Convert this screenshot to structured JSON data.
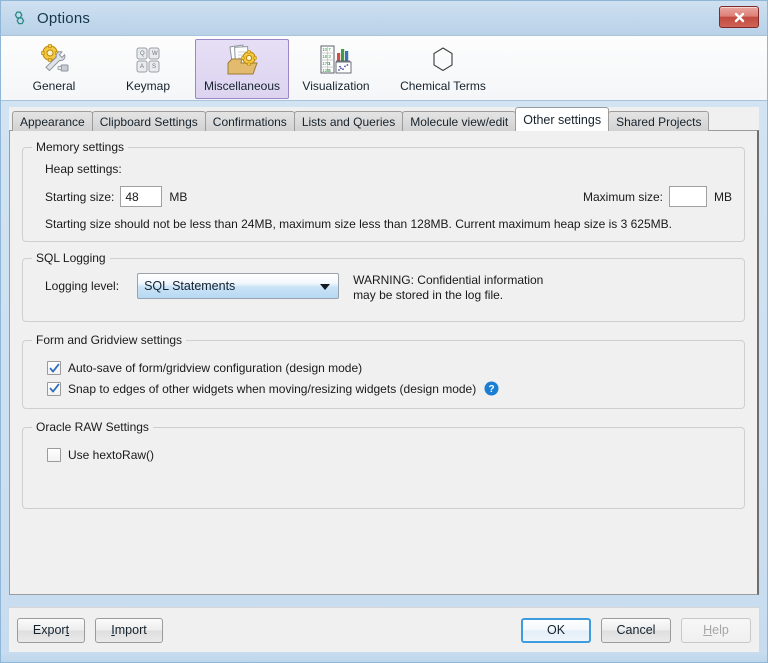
{
  "window": {
    "title": "Options",
    "title_icon": "molecule-icon",
    "close_label": "x"
  },
  "toolbar": {
    "items": [
      {
        "label": "General",
        "icon": "gear-wrench-icon",
        "selected": false
      },
      {
        "label": "Keymap",
        "icon": "keyboard-keys-icon",
        "selected": false
      },
      {
        "label": "Miscellaneous",
        "icon": "folder-gear-icon",
        "selected": true
      },
      {
        "label": "Visualization",
        "icon": "table-chart-icon",
        "selected": false
      },
      {
        "label": "Chemical Terms",
        "icon": "benzene-ring-icon",
        "selected": false
      }
    ]
  },
  "tabs": [
    {
      "label": "Appearance",
      "active": false
    },
    {
      "label": "Clipboard Settings",
      "active": false
    },
    {
      "label": "Confirmations",
      "active": false
    },
    {
      "label": "Lists and Queries",
      "active": false
    },
    {
      "label": "Molecule view/edit",
      "active": false
    },
    {
      "label": "Other settings",
      "active": true
    },
    {
      "label": "Shared Projects",
      "active": false
    }
  ],
  "memory": {
    "group_title": "Memory settings",
    "heap_label": "Heap settings:",
    "starting_label": "Starting size:",
    "starting_value": "48",
    "starting_unit": "MB",
    "maximum_label": "Maximum size:",
    "maximum_value": "",
    "maximum_unit": "MB",
    "hint": "Starting size should not be less than 24MB, maximum size less than 128MB. Current maximum heap size is 3 625MB."
  },
  "sql_logging": {
    "group_title": "SQL Logging",
    "level_label": "Logging level:",
    "level_value": "SQL Statements",
    "warning_line1": "WARNING: Confidential information",
    "warning_line2": "may be stored in the log file."
  },
  "form_gridview": {
    "group_title": "Form and Gridview settings",
    "autosave_label": "Auto-save of form/gridview configuration (design mode)",
    "autosave_checked": true,
    "snap_label": "Snap to edges of other widgets when moving/resizing widgets (design mode)",
    "snap_checked": true,
    "help_icon": "help-circle-icon"
  },
  "oracle_raw": {
    "group_title": "Oracle RAW Settings",
    "hextoraw_label": "Use hextoRaw()",
    "hextoraw_checked": false
  },
  "buttons": {
    "export": "Export",
    "export_mnemonic": "t",
    "import": "Import",
    "import_mnemonic": "I",
    "ok": "OK",
    "cancel": "Cancel",
    "help": "Help",
    "help_mnemonic": "H",
    "help_disabled": true
  },
  "colors": {
    "window_frame": "#c8dcef",
    "titlebar": "#c2d8ec",
    "close_red": "#c24a3f",
    "selected_tool": "#ddd4f0",
    "combo_blue": "#b7d9f3",
    "check_blue": "#2f6fbf",
    "default_button_border": "#3e9bdd",
    "panel_bg": "#f0f0f0"
  }
}
